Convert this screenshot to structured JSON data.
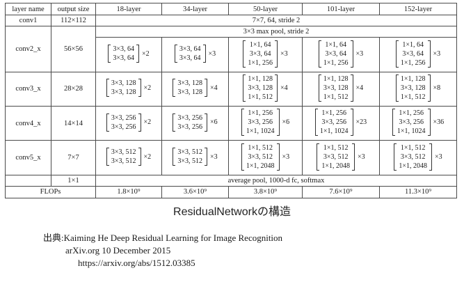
{
  "table": {
    "headers": [
      "layer name",
      "output size",
      "18-layer",
      "34-layer",
      "50-layer",
      "101-layer",
      "152-layer"
    ],
    "conv1": {
      "name": "conv1",
      "size": "112×112",
      "desc": "7×7, 64, stride 2"
    },
    "pool": {
      "desc": "3×3 max pool, stride 2"
    },
    "stages": [
      {
        "name": "conv2_x",
        "size": "56×56",
        "cells": [
          {
            "lines": [
              "3×3, 64",
              "3×3, 64"
            ],
            "mult": "×2"
          },
          {
            "lines": [
              "3×3, 64",
              "3×3, 64"
            ],
            "mult": "×3"
          },
          {
            "lines": [
              "1×1, 64",
              "3×3, 64",
              "1×1, 256"
            ],
            "mult": "×3"
          },
          {
            "lines": [
              "1×1, 64",
              "3×3, 64",
              "1×1, 256"
            ],
            "mult": "×3"
          },
          {
            "lines": [
              "1×1, 64",
              "3×3, 64",
              "1×1, 256"
            ],
            "mult": "×3"
          }
        ]
      },
      {
        "name": "conv3_x",
        "size": "28×28",
        "cells": [
          {
            "lines": [
              "3×3, 128",
              "3×3, 128"
            ],
            "mult": "×2"
          },
          {
            "lines": [
              "3×3, 128",
              "3×3, 128"
            ],
            "mult": "×4"
          },
          {
            "lines": [
              "1×1, 128",
              "3×3, 128",
              "1×1, 512"
            ],
            "mult": "×4"
          },
          {
            "lines": [
              "1×1, 128",
              "3×3, 128",
              "1×1, 512"
            ],
            "mult": "×4"
          },
          {
            "lines": [
              "1×1, 128",
              "3×3, 128",
              "1×1, 512"
            ],
            "mult": "×8"
          }
        ]
      },
      {
        "name": "conv4_x",
        "size": "14×14",
        "cells": [
          {
            "lines": [
              "3×3, 256",
              "3×3, 256"
            ],
            "mult": "×2"
          },
          {
            "lines": [
              "3×3, 256",
              "3×3, 256"
            ],
            "mult": "×6"
          },
          {
            "lines": [
              "1×1, 256",
              "3×3, 256",
              "1×1, 1024"
            ],
            "mult": "×6"
          },
          {
            "lines": [
              "1×1, 256",
              "3×3, 256",
              "1×1, 1024"
            ],
            "mult": "×23"
          },
          {
            "lines": [
              "1×1, 256",
              "3×3, 256",
              "1×1, 1024"
            ],
            "mult": "×36"
          }
        ]
      },
      {
        "name": "conv5_x",
        "size": "7×7",
        "cells": [
          {
            "lines": [
              "3×3, 512",
              "3×3, 512"
            ],
            "mult": "×2"
          },
          {
            "lines": [
              "3×3, 512",
              "3×3, 512"
            ],
            "mult": "×3"
          },
          {
            "lines": [
              "1×1, 512",
              "3×3, 512",
              "1×1, 2048"
            ],
            "mult": "×3"
          },
          {
            "lines": [
              "1×1, 512",
              "3×3, 512",
              "1×1, 2048"
            ],
            "mult": "×3"
          },
          {
            "lines": [
              "1×1, 512",
              "3×3, 512",
              "1×1, 2048"
            ],
            "mult": "×3"
          }
        ]
      }
    ],
    "avg": {
      "size": "1×1",
      "desc": "average pool, 1000-d fc, softmax"
    },
    "flops": {
      "label": "FLOPs",
      "values": [
        "1.8×10⁹",
        "3.6×10⁹",
        "3.8×10⁹",
        "7.6×10⁹",
        "11.3×10⁹"
      ]
    }
  },
  "caption": "ResidualNetworkの構造",
  "source": {
    "line1": "出典:Kaiming He   Deep Residual Learning for Image Recognition",
    "line2": "arXiv.org 10 December 2015",
    "line3": "https://arxiv.org/abs/1512.03385"
  }
}
